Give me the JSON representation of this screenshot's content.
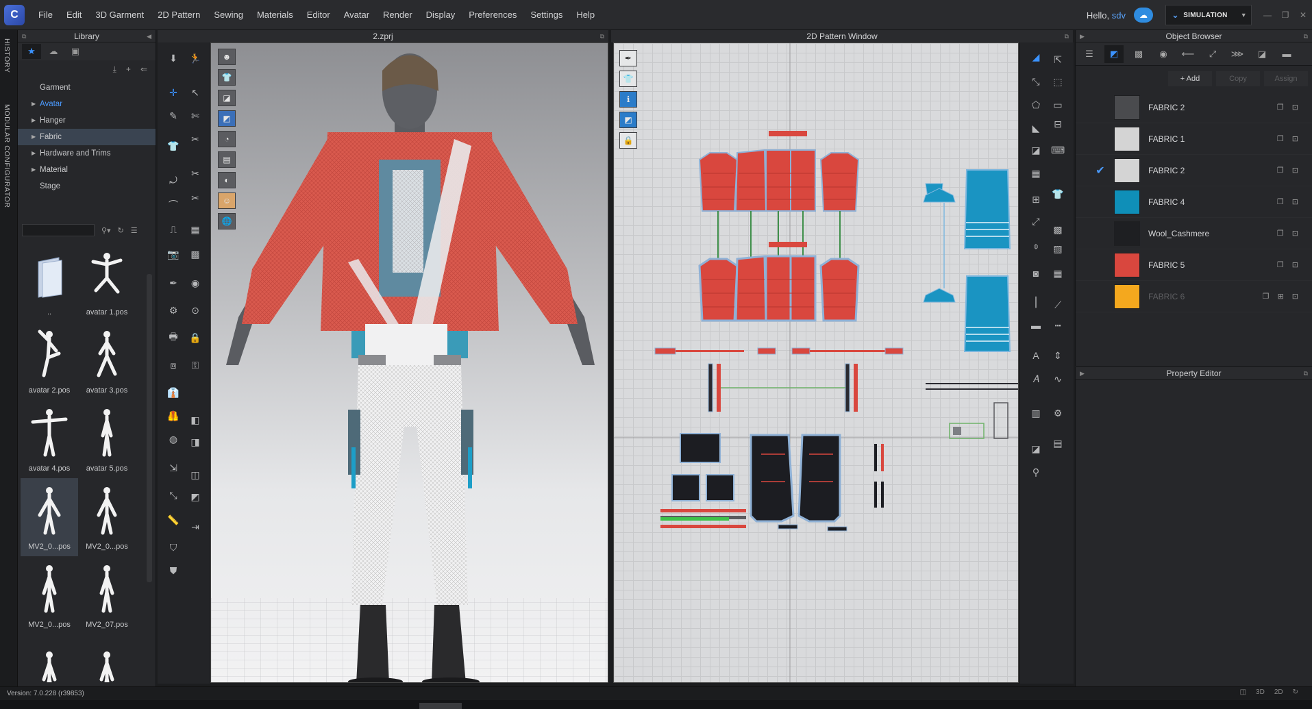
{
  "menubar": {
    "items": [
      "File",
      "Edit",
      "3D Garment",
      "2D Pattern",
      "Sewing",
      "Materials",
      "Editor",
      "Avatar",
      "Render",
      "Display",
      "Preferences",
      "Settings",
      "Help"
    ],
    "hello": "Hello,",
    "user": "sdv",
    "mode_label": "SIMULATION"
  },
  "sidestrip": {
    "history": "HISTORY",
    "modular": "MODULAR CONFIGURATOR"
  },
  "library": {
    "title": "Library",
    "tree": [
      {
        "label": "Garment"
      },
      {
        "label": "Avatar"
      },
      {
        "label": "Hanger"
      },
      {
        "label": "Fabric"
      },
      {
        "label": "Hardware and Trims"
      },
      {
        "label": "Material"
      },
      {
        "label": "Stage"
      }
    ],
    "thumbs": [
      "..",
      "avatar 1.pos",
      "avatar 2.pos",
      "avatar 3.pos",
      "avatar 4.pos",
      "avatar 5.pos",
      "MV2_0...pos",
      "MV2_0...pos",
      "MV2_0...pos",
      "MV2_07.pos",
      "",
      ""
    ]
  },
  "window3d": {
    "title": "2.zprj"
  },
  "window2d": {
    "title": "2D Pattern Window"
  },
  "object_browser": {
    "title": "Object Browser",
    "add_label": "+ Add",
    "copy_label": "Copy",
    "assign_label": "Assign",
    "fabrics": [
      {
        "name": "FABRIC 2",
        "color": "#4a4b4e",
        "checked": false
      },
      {
        "name": "FABRIC 1",
        "color": "#d4d4d4",
        "checked": false
      },
      {
        "name": "FABRIC 2",
        "color": "#d4d4d4",
        "checked": true
      },
      {
        "name": "FABRIC 4",
        "color": "#0f8fb8",
        "checked": false
      },
      {
        "name": "Wool_Cashmere",
        "color": "#1e1f22",
        "checked": false
      },
      {
        "name": "FABRIC 5",
        "color": "#d9473e",
        "checked": false
      },
      {
        "name": "FABRIC 6",
        "color": "#f4a81e",
        "checked": false
      }
    ]
  },
  "property_editor": {
    "title": "Property Editor"
  },
  "status": {
    "version": "Version: 7.0.228 (r39853)",
    "view_3d": "3D",
    "view_2d": "2D"
  }
}
